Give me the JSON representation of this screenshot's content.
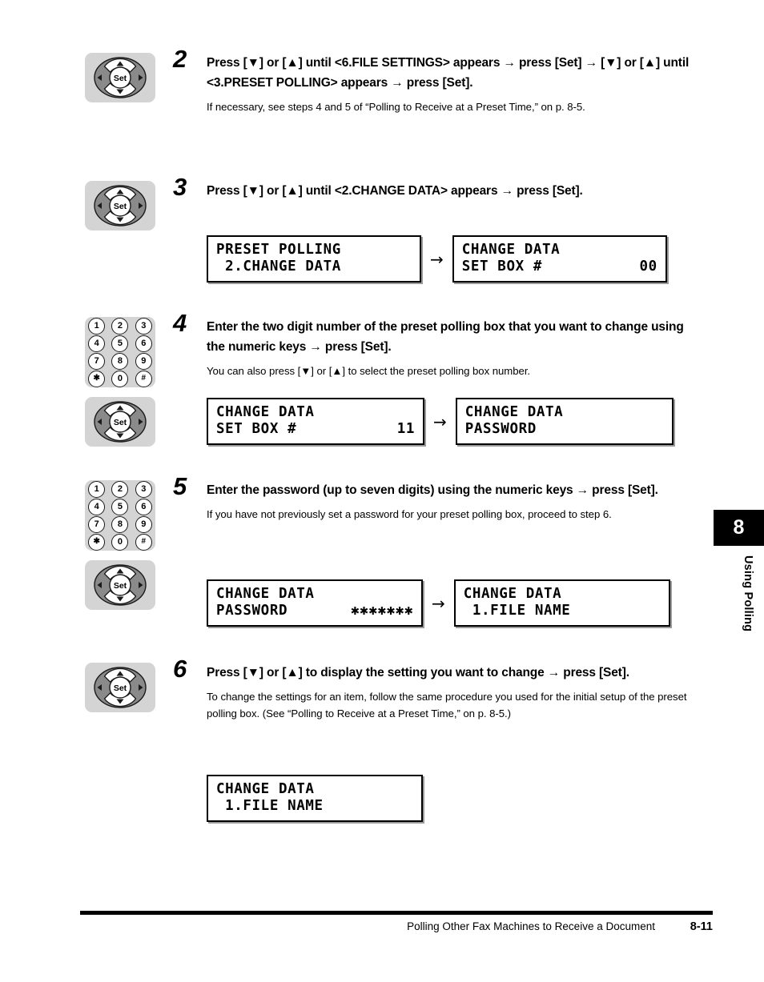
{
  "page": {
    "footer_title": "Polling Other Fax Machines to Receive a Document",
    "footer_page": "8-11",
    "chapter_number": "8",
    "chapter_label": "Using Polling"
  },
  "keypad": {
    "keys": [
      "1",
      "2",
      "3",
      "4",
      "5",
      "6",
      "7",
      "8",
      "9",
      "✱",
      "0",
      "#"
    ]
  },
  "nav_icon": {
    "set_label": "Set"
  },
  "steps": [
    {
      "number": "2",
      "title": "Press [▼] or [▲] until <6.FILE SETTINGS> appears → press [Set] → [▼] or [▲] until <3.PRESET POLLING> appears → press [Set].",
      "note": "If necessary, see steps 4 and 5 of “Polling to Receive at a Preset Time,” on p. 8-5.",
      "icons": [
        "nav"
      ],
      "lcds": []
    },
    {
      "number": "3",
      "title": "Press [▼] or [▲] until <2.CHANGE DATA> appears → press [Set].",
      "note": "",
      "icons": [
        "nav"
      ],
      "lcds": [
        {
          "line1_left": "PRESET POLLING",
          "line1_right": "",
          "line2_left": " 2.CHANGE DATA",
          "line2_right": ""
        },
        {
          "arrow": "→",
          "line1_left": "CHANGE DATA",
          "line1_right": "",
          "line2_left": "SET BOX #",
          "line2_right": "00"
        }
      ]
    },
    {
      "number": "4",
      "title": "Enter the two digit number of the preset polling box that you want to change using the numeric keys → press [Set].",
      "note": "You can also press [▼] or [▲] to select the preset polling box number.",
      "icons": [
        "keypad",
        "nav"
      ],
      "lcds": [
        {
          "line1_left": "CHANGE DATA",
          "line1_right": "",
          "line2_left": "SET BOX #",
          "line2_right": "11"
        },
        {
          "arrow": "→",
          "line1_left": "CHANGE DATA",
          "line1_right": "",
          "line2_left": "PASSWORD",
          "line2_right": ""
        }
      ]
    },
    {
      "number": "5",
      "title": "Enter the password (up to seven digits) using the numeric keys → press [Set].",
      "note": "If you have not previously set a password for your preset polling box, proceed to step 6.",
      "icons": [
        "keypad",
        "nav"
      ],
      "lcds": [
        {
          "line1_left": "CHANGE DATA",
          "line1_right": "",
          "line2_left": "PASSWORD",
          "line2_right": "✱✱✱✱✱✱✱"
        },
        {
          "arrow": "→",
          "line1_left": "CHANGE DATA",
          "line1_right": "",
          "line2_left": " 1.FILE NAME",
          "line2_right": ""
        }
      ]
    },
    {
      "number": "6",
      "title": "Press [▼] or [▲] to display the setting you want to change → press [Set].",
      "note": "To change the settings for an item, follow the same procedure you used for the initial setup of the preset polling box. (See “Polling to Receive at a Preset Time,” on p. 8-5.)",
      "icons": [
        "nav"
      ],
      "lcds": [
        {
          "line1_left": "CHANGE DATA",
          "line1_right": "",
          "line2_left": " 1.FILE NAME",
          "line2_right": ""
        }
      ]
    }
  ]
}
